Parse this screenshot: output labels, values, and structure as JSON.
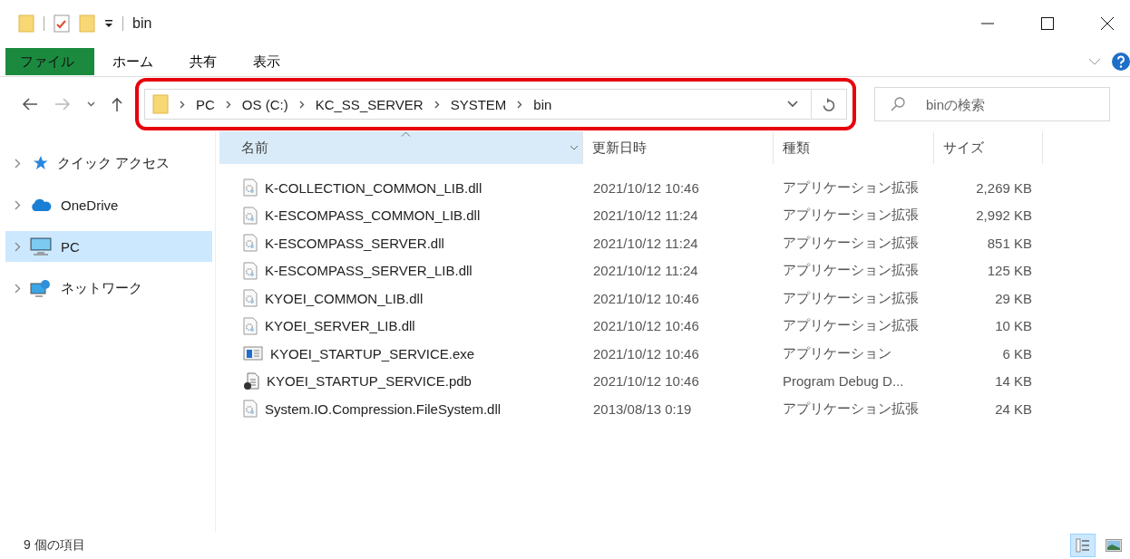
{
  "window": {
    "title": "bin"
  },
  "ribbon_tabs": [
    {
      "label": "ファイル",
      "kind": "file",
      "selected": false
    },
    {
      "label": "ホーム",
      "kind": "tab",
      "selected": false
    },
    {
      "label": "共有",
      "kind": "tab",
      "selected": false
    },
    {
      "label": "表示",
      "kind": "tab",
      "selected": false
    }
  ],
  "address_bar": {
    "highlighted": true,
    "path": [
      "PC",
      "OS (C:)",
      "KC_SS_SERVER",
      "SYSTEM",
      "bin"
    ]
  },
  "search": {
    "placeholder": "binの検索"
  },
  "sidebar": {
    "items": [
      {
        "label": "クイック アクセス",
        "kind": "quick",
        "selected": false
      },
      {
        "label": "OneDrive",
        "kind": "cloud",
        "selected": false
      },
      {
        "label": "PC",
        "kind": "pc",
        "selected": true
      },
      {
        "label": "ネットワーク",
        "kind": "network",
        "selected": false
      }
    ]
  },
  "table": {
    "columns": [
      {
        "label": "名前",
        "sorted": true
      },
      {
        "label": "更新日時",
        "sorted": false
      },
      {
        "label": "種類",
        "sorted": false
      },
      {
        "label": "サイズ",
        "sorted": false
      }
    ],
    "rows": [
      {
        "kind": "dll",
        "name": "K-COLLECTION_COMMON_LIB.dll",
        "date": "2021/10/12 10:46",
        "type": "アプリケーション拡張",
        "size": "2,269 KB"
      },
      {
        "kind": "dll",
        "name": "K-ESCOMPASS_COMMON_LIB.dll",
        "date": "2021/10/12 11:24",
        "type": "アプリケーション拡張",
        "size": "2,992 KB"
      },
      {
        "kind": "dll",
        "name": "K-ESCOMPASS_SERVER.dll",
        "date": "2021/10/12 11:24",
        "type": "アプリケーション拡張",
        "size": "851 KB"
      },
      {
        "kind": "dll",
        "name": "K-ESCOMPASS_SERVER_LIB.dll",
        "date": "2021/10/12 11:24",
        "type": "アプリケーション拡張",
        "size": "125 KB"
      },
      {
        "kind": "dll",
        "name": "KYOEI_COMMON_LIB.dll",
        "date": "2021/10/12 10:46",
        "type": "アプリケーション拡張",
        "size": "29 KB"
      },
      {
        "kind": "dll",
        "name": "KYOEI_SERVER_LIB.dll",
        "date": "2021/10/12 10:46",
        "type": "アプリケーション拡張",
        "size": "10 KB"
      },
      {
        "kind": "exe",
        "name": "KYOEI_STARTUP_SERVICE.exe",
        "date": "2021/10/12 10:46",
        "type": "アプリケーション",
        "size": "6 KB"
      },
      {
        "kind": "pdb",
        "name": "KYOEI_STARTUP_SERVICE.pdb",
        "date": "2021/10/12 10:46",
        "type": "Program Debug D...",
        "size": "14 KB"
      },
      {
        "kind": "dll",
        "name": "System.IO.Compression.FileSystem.dll",
        "date": "2013/08/13 0:19",
        "type": "アプリケーション拡張",
        "size": "24 KB"
      }
    ]
  },
  "status_bar": {
    "count": "9 個の項目",
    "views": [
      {
        "kind": "details",
        "selected": true
      },
      {
        "kind": "tiles",
        "selected": false
      }
    ]
  }
}
